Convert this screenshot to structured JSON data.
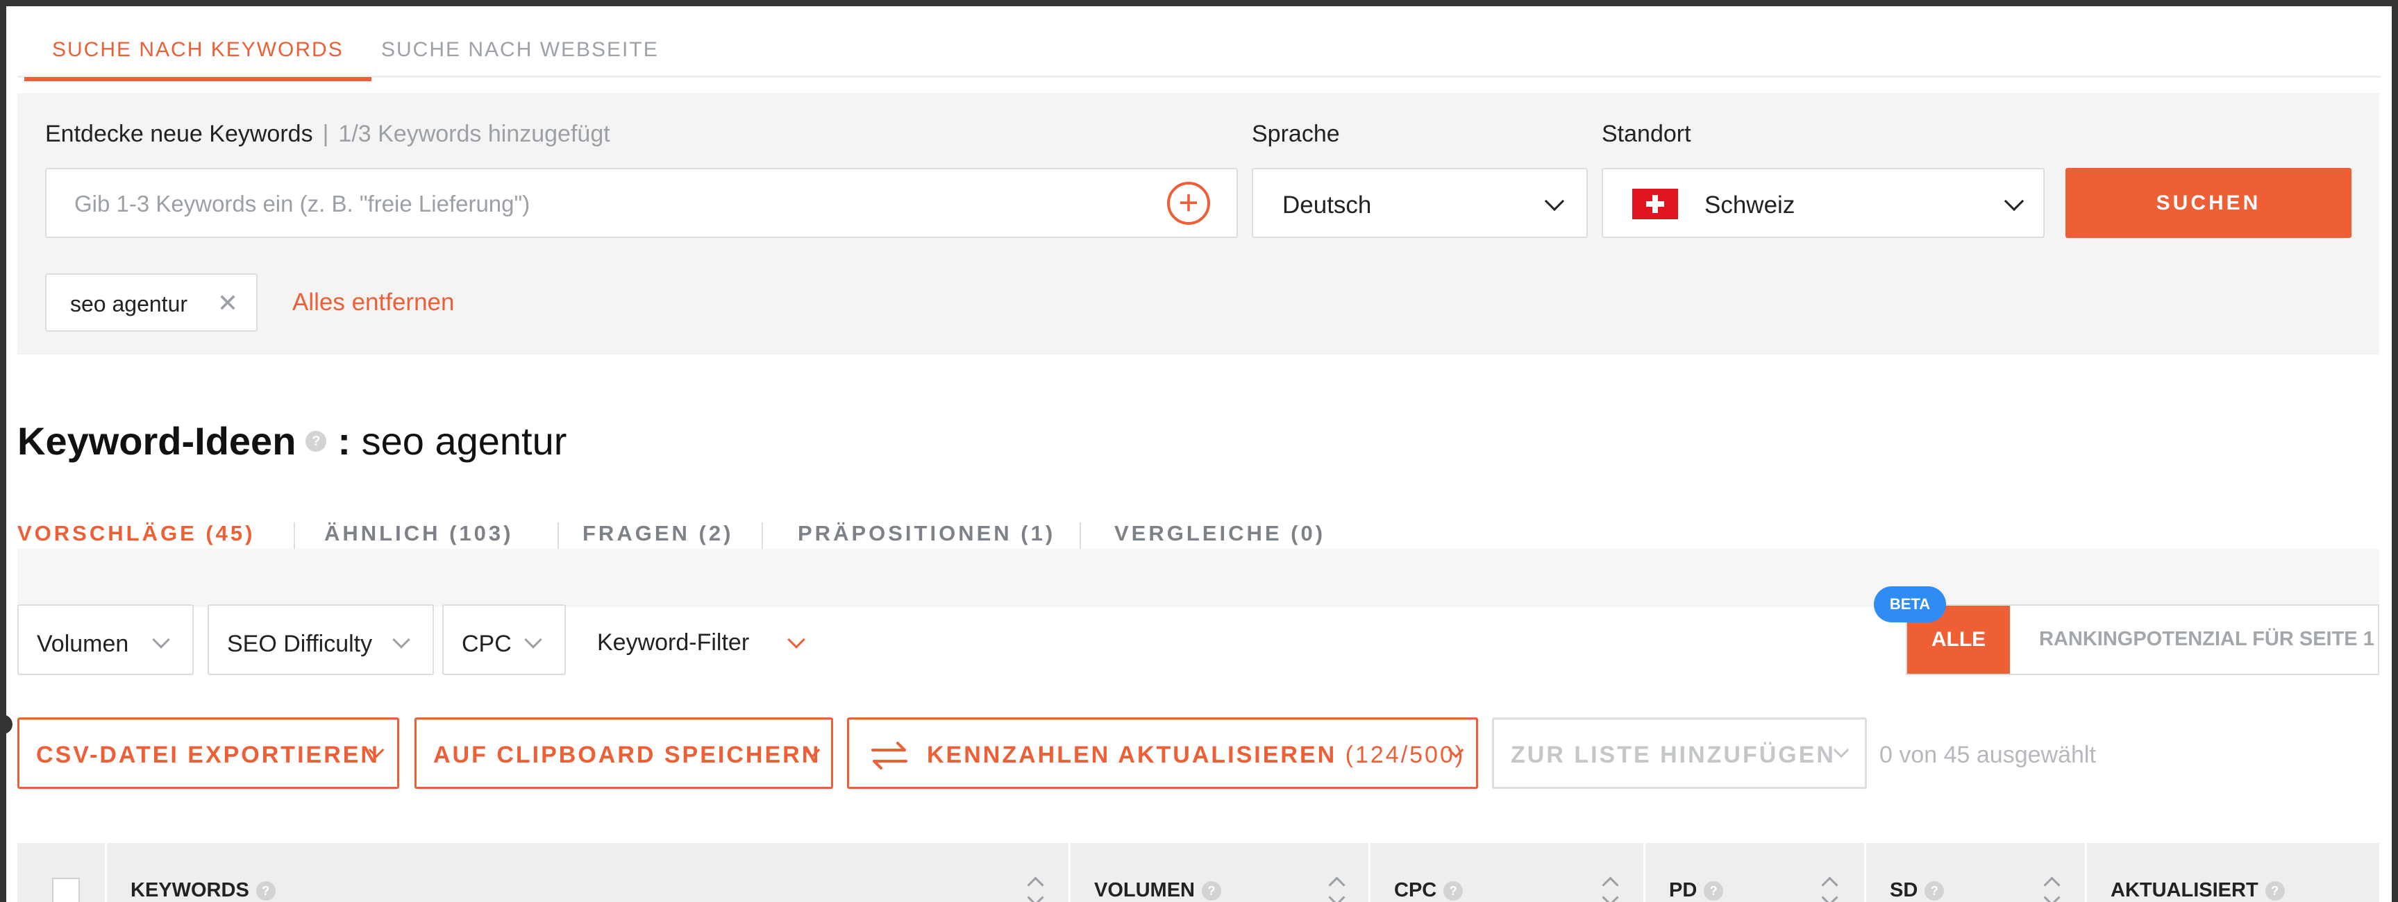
{
  "top_tabs": [
    {
      "label": "SUCHE NACH KEYWORDS",
      "active": true
    },
    {
      "label": "SUCHE NACH WEBSEITE",
      "active": false
    }
  ],
  "search": {
    "label": "Entdecke neue Keywords",
    "counter": "1/3 Keywords hinzugefügt",
    "placeholder": "Gib 1-3 Keywords ein (z. B. \"freie Lieferung\")",
    "language_label": "Sprache",
    "language_value": "Deutsch",
    "location_label": "Standort",
    "location_value": "Schweiz",
    "submit_label": "SUCHEN",
    "chips": [
      "seo agentur"
    ],
    "remove_all_label": "Alles entfernen"
  },
  "heading": {
    "title": "Keyword-Ideen",
    "colon": ":",
    "keyword": "seo agentur"
  },
  "sub_tabs": [
    {
      "label": "VORSCHLÄGE (45)",
      "active": true
    },
    {
      "label": "ÄHNLICH (103)",
      "active": false
    },
    {
      "label": "FRAGEN (2)",
      "active": false
    },
    {
      "label": "PRÄPOSITIONEN (1)",
      "active": false
    },
    {
      "label": "VERGLEICHE (0)",
      "active": false
    }
  ],
  "filters": [
    "Volumen",
    "SEO Difficulty",
    "CPC",
    "Keyword-Filter"
  ],
  "ranking_toggle": {
    "badge": "BETA",
    "active_label": "ALLE",
    "inactive_label": "RANKINGPOTENZIAL FÜR SEITE 1"
  },
  "actions": {
    "export": "CSV-DATEI EXPORTIEREN",
    "clipboard": "AUF CLIPBOARD SPEICHERN",
    "refresh": "KENNZAHLEN AKTUALISIEREN",
    "refresh_count": "(124/500)",
    "add_to_list": "ZUR LISTE HINZUFÜGEN",
    "selection": "0 von 45 ausgewählt"
  },
  "table": {
    "columns": [
      "KEYWORDS",
      "VOLUMEN",
      "CPC",
      "PD",
      "SD",
      "AKTUALISIERT"
    ]
  },
  "colors": {
    "accent": "#ee5f36",
    "beta": "#2e8cf2",
    "panel": "#f4f4f4"
  }
}
